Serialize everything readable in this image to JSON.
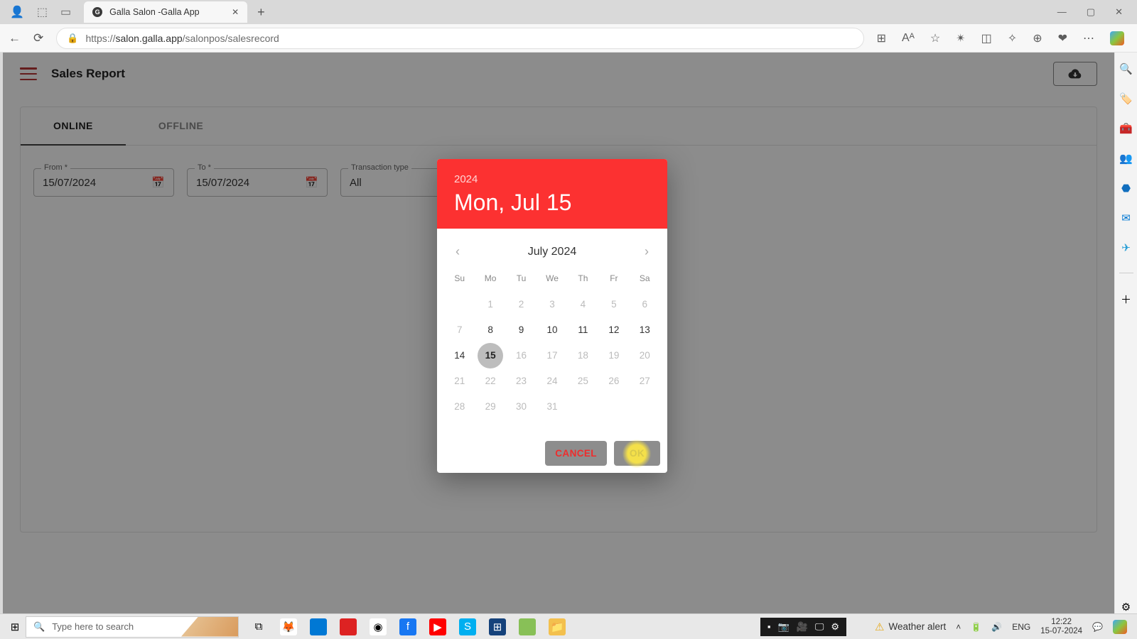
{
  "browser": {
    "tab_title": "Galla Salon -Galla App",
    "url_host": "salon.galla.app",
    "url_scheme": "https://",
    "url_path": "/salonpos/salesrecord"
  },
  "win_controls": {
    "min": "—",
    "max": "▢",
    "close": "✕"
  },
  "app": {
    "title": "Sales Report",
    "tabs": {
      "online": "ONLINE",
      "offline": "OFFLINE"
    },
    "filters": {
      "from_label": "From *",
      "from_value": "15/07/2024",
      "to_label": "To *",
      "to_value": "15/07/2024",
      "txn_label": "Transaction type",
      "txn_value": "All"
    }
  },
  "datepicker": {
    "year": "2024",
    "full_date": "Mon, Jul 15",
    "month_label": "July 2024",
    "dow": [
      "Su",
      "Mo",
      "Tu",
      "We",
      "Th",
      "Fr",
      "Sa"
    ],
    "weeks": [
      [
        {
          "n": "",
          "s": "empty"
        },
        {
          "n": "1",
          "s": "dim"
        },
        {
          "n": "2",
          "s": "dim"
        },
        {
          "n": "3",
          "s": "dim"
        },
        {
          "n": "4",
          "s": "dim"
        },
        {
          "n": "5",
          "s": "dim"
        },
        {
          "n": "6",
          "s": "dim"
        }
      ],
      [
        {
          "n": "7",
          "s": "dim"
        },
        {
          "n": "8",
          "s": ""
        },
        {
          "n": "9",
          "s": ""
        },
        {
          "n": "10",
          "s": ""
        },
        {
          "n": "11",
          "s": ""
        },
        {
          "n": "12",
          "s": ""
        },
        {
          "n": "13",
          "s": ""
        }
      ],
      [
        {
          "n": "14",
          "s": ""
        },
        {
          "n": "15",
          "s": "selected"
        },
        {
          "n": "16",
          "s": "dim"
        },
        {
          "n": "17",
          "s": "dim"
        },
        {
          "n": "18",
          "s": "dim"
        },
        {
          "n": "19",
          "s": "dim"
        },
        {
          "n": "20",
          "s": "dim"
        }
      ],
      [
        {
          "n": "21",
          "s": "dim"
        },
        {
          "n": "22",
          "s": "dim"
        },
        {
          "n": "23",
          "s": "dim"
        },
        {
          "n": "24",
          "s": "dim"
        },
        {
          "n": "25",
          "s": "dim"
        },
        {
          "n": "26",
          "s": "dim"
        },
        {
          "n": "27",
          "s": "dim"
        }
      ],
      [
        {
          "n": "28",
          "s": "dim"
        },
        {
          "n": "29",
          "s": "dim"
        },
        {
          "n": "30",
          "s": "dim"
        },
        {
          "n": "31",
          "s": "dim"
        },
        {
          "n": "",
          "s": "empty"
        },
        {
          "n": "",
          "s": "empty"
        },
        {
          "n": "",
          "s": "empty"
        }
      ]
    ],
    "cancel": "CANCEL",
    "ok": "OK"
  },
  "taskbar": {
    "search_placeholder": "Type here to search",
    "weather": "Weather alert",
    "lang": "ENG",
    "time": "12:22",
    "date": "15-07-2024"
  }
}
